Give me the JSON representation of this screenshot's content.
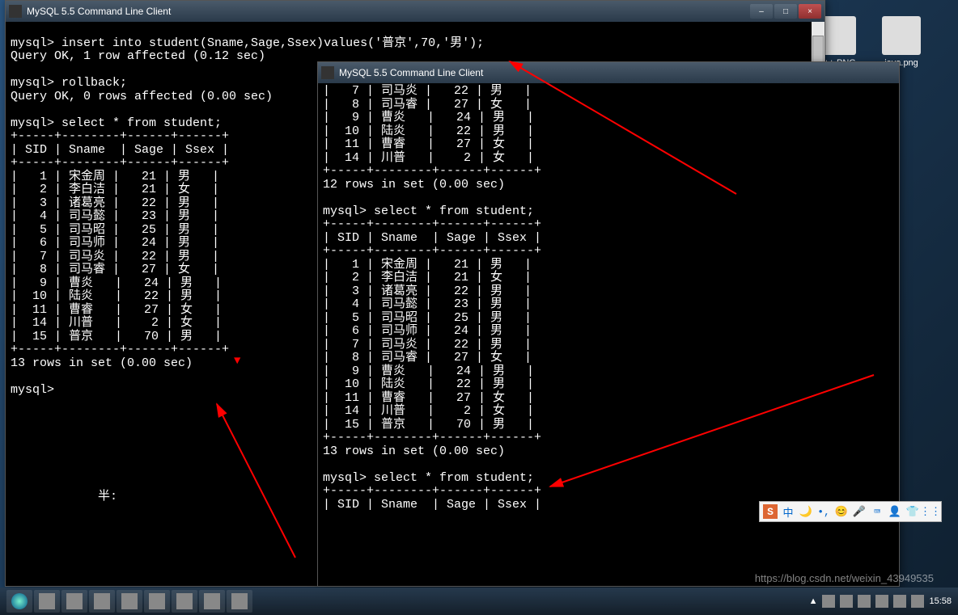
{
  "desktop": {
    "icons": [
      {
        "label": "C++.PNG"
      },
      {
        "label": "java.png"
      }
    ]
  },
  "window1": {
    "title": "MySQL 5.5 Command Line Client",
    "prompt": "mysql>",
    "lines": {
      "l1": "mysql> insert into student(Sname,Sage,Ssex)values('普京',70,'男');",
      "l2": "Query OK, 1 row affected (0.12 sec)",
      "l3": "mysql> rollback;",
      "l4": "Query OK, 0 rows affected (0.00 sec)",
      "l5": "mysql> select * from student;",
      "sep": "+-----+--------+------+------+",
      "hdr": "| SID | Sname  | Sage | Ssex |",
      "footer": "13 rows in set (0.00 sec)",
      "bottom_prompt": "mysql>",
      "ime_hint": "半:"
    },
    "rows": [
      {
        "sid": "1",
        "name": "宋金周",
        "age": "21",
        "sex": "男"
      },
      {
        "sid": "2",
        "name": "李白洁",
        "age": "21",
        "sex": "女"
      },
      {
        "sid": "3",
        "name": "诸葛亮",
        "age": "22",
        "sex": "男"
      },
      {
        "sid": "4",
        "name": "司马懿",
        "age": "23",
        "sex": "男"
      },
      {
        "sid": "5",
        "name": "司马昭",
        "age": "25",
        "sex": "男"
      },
      {
        "sid": "6",
        "name": "司马师",
        "age": "24",
        "sex": "男"
      },
      {
        "sid": "7",
        "name": "司马炎",
        "age": "22",
        "sex": "男"
      },
      {
        "sid": "8",
        "name": "司马睿",
        "age": "27",
        "sex": "女"
      },
      {
        "sid": "9",
        "name": "曹炎  ",
        "age": "24",
        "sex": "男"
      },
      {
        "sid": "10",
        "name": "陆炎  ",
        "age": "22",
        "sex": "男"
      },
      {
        "sid": "11",
        "name": "曹睿  ",
        "age": "27",
        "sex": "女"
      },
      {
        "sid": "14",
        "name": "川普  ",
        "age": "2",
        "sex": "女"
      },
      {
        "sid": "15",
        "name": "普京  ",
        "age": "70",
        "sex": "男"
      }
    ]
  },
  "window2": {
    "title": "MySQL 5.5 Command Line Client",
    "top_rows": [
      {
        "sid": "7",
        "name": "司马炎",
        "age": "22",
        "sex": "男"
      },
      {
        "sid": "8",
        "name": "司马睿",
        "age": "27",
        "sex": "女"
      },
      {
        "sid": "9",
        "name": "曹炎  ",
        "age": "24",
        "sex": "男"
      },
      {
        "sid": "10",
        "name": "陆炎  ",
        "age": "22",
        "sex": "男"
      },
      {
        "sid": "11",
        "name": "曹睿  ",
        "age": "27",
        "sex": "女"
      },
      {
        "sid": "14",
        "name": "川普  ",
        "age": "2",
        "sex": "女"
      }
    ],
    "top_footer": "12 rows in set (0.00 sec)",
    "query": "mysql> select * from student;",
    "sep": "+-----+--------+------+------+",
    "hdr": "| SID | Sname  | Sage | Ssex |",
    "rows": [
      {
        "sid": "1",
        "name": "宋金周",
        "age": "21",
        "sex": "男"
      },
      {
        "sid": "2",
        "name": "李白洁",
        "age": "21",
        "sex": "女"
      },
      {
        "sid": "3",
        "name": "诸葛亮",
        "age": "22",
        "sex": "男"
      },
      {
        "sid": "4",
        "name": "司马懿",
        "age": "23",
        "sex": "男"
      },
      {
        "sid": "5",
        "name": "司马昭",
        "age": "25",
        "sex": "男"
      },
      {
        "sid": "6",
        "name": "司马师",
        "age": "24",
        "sex": "男"
      },
      {
        "sid": "7",
        "name": "司马炎",
        "age": "22",
        "sex": "男"
      },
      {
        "sid": "8",
        "name": "司马睿",
        "age": "27",
        "sex": "女"
      },
      {
        "sid": "9",
        "name": "曹炎  ",
        "age": "24",
        "sex": "男"
      },
      {
        "sid": "10",
        "name": "陆炎  ",
        "age": "22",
        "sex": "男"
      },
      {
        "sid": "11",
        "name": "曹睿  ",
        "age": "27",
        "sex": "女"
      },
      {
        "sid": "14",
        "name": "川普  ",
        "age": "2",
        "sex": "女"
      },
      {
        "sid": "15",
        "name": "普京  ",
        "age": "70",
        "sex": "男"
      }
    ],
    "footer": "13 rows in set (0.00 sec)",
    "query2": "mysql> select * from student;"
  },
  "ime": {
    "logo": "S",
    "items": [
      "中",
      "🌙",
      "•,",
      "😊",
      "🎤",
      "⌨",
      "👤",
      "👕",
      "⋮⋮"
    ]
  },
  "tray": {
    "time": "15:58",
    "watermark": "https://blog.csdn.net/weixin_43949535"
  }
}
